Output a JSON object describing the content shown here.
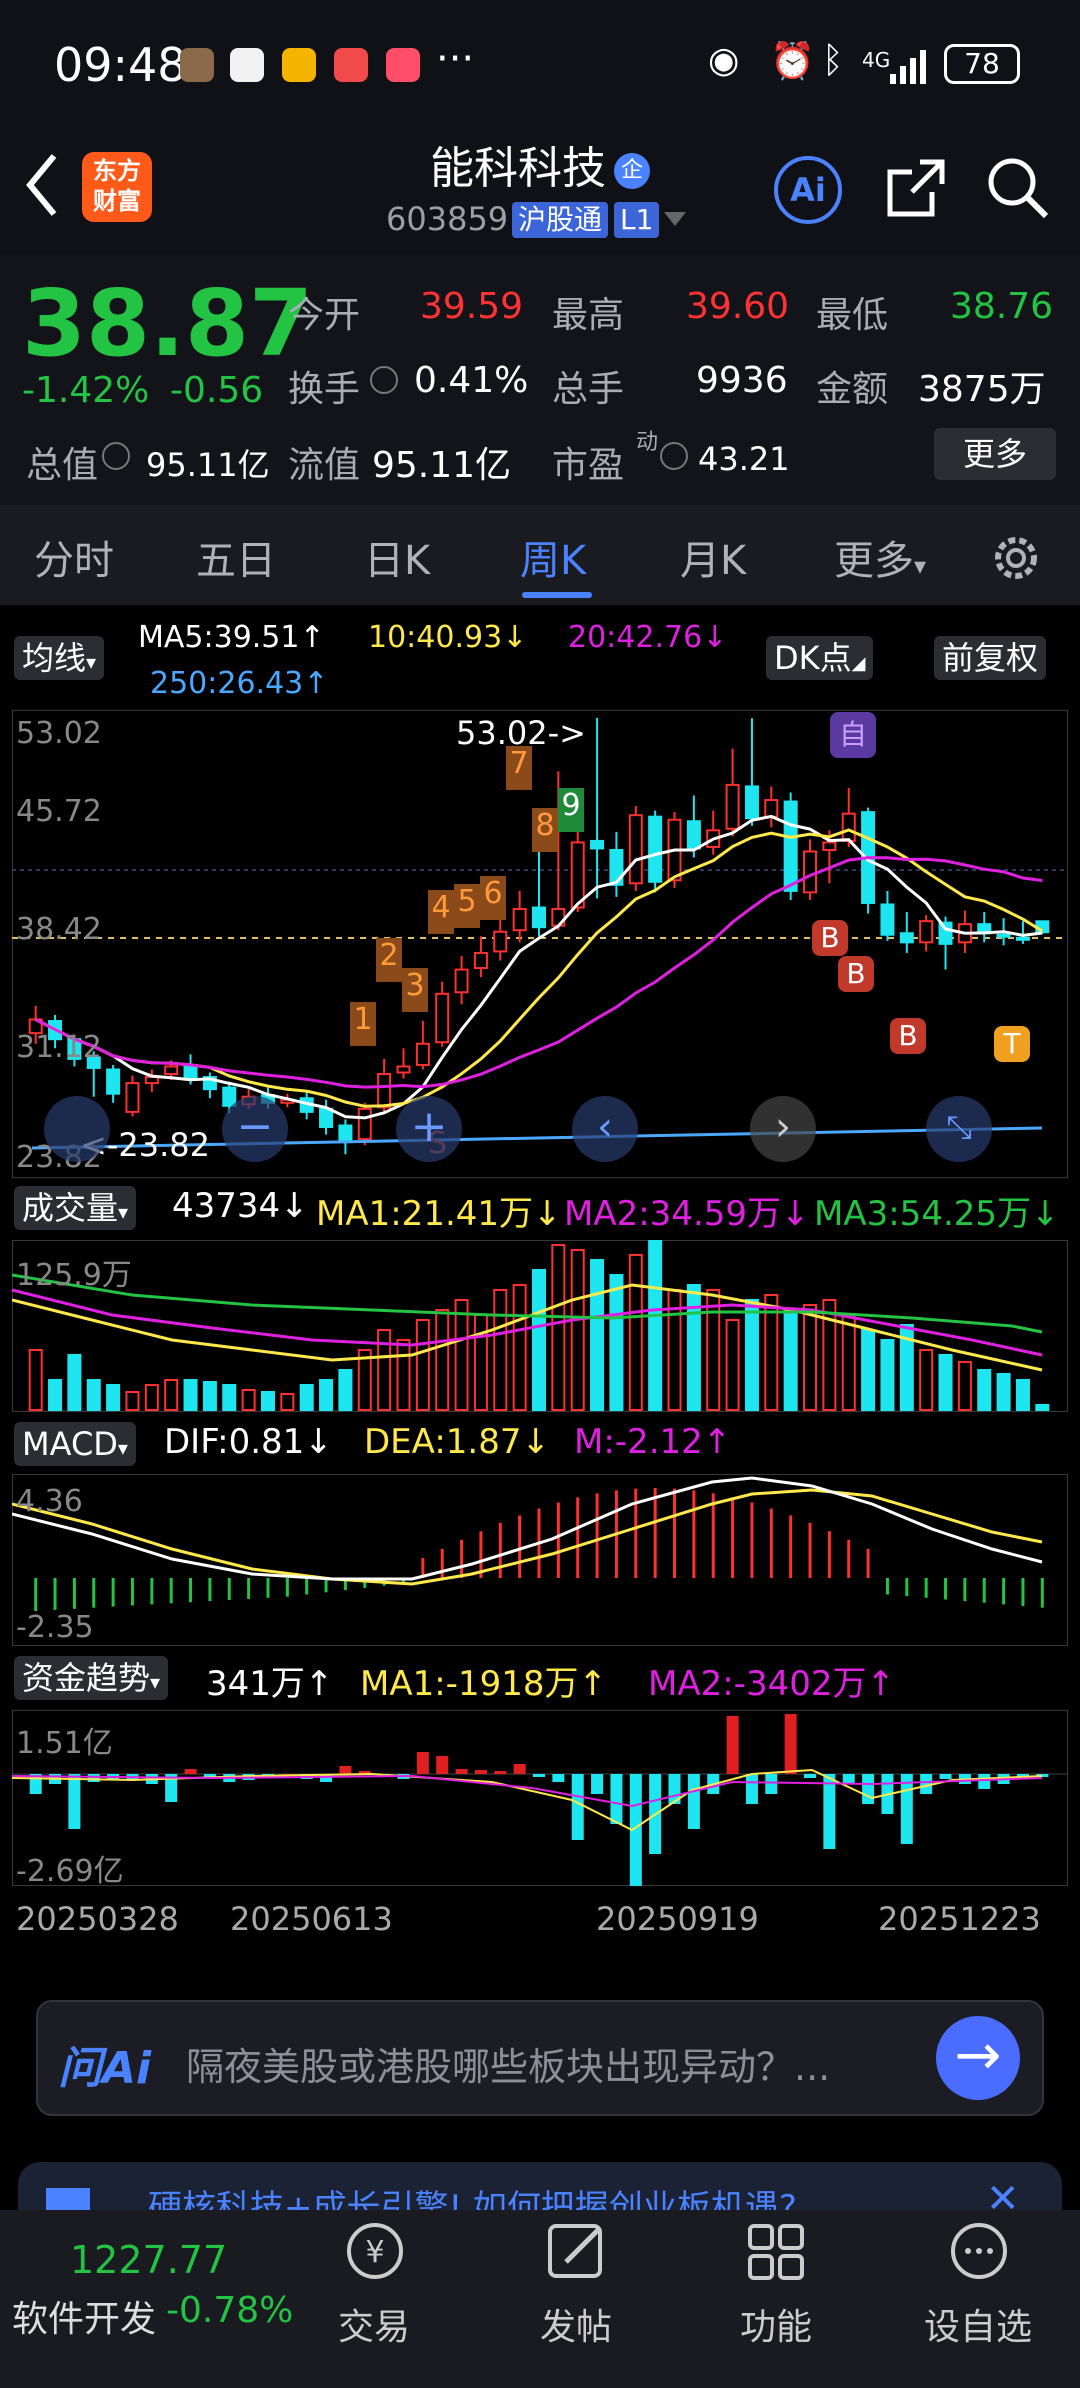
{
  "status_bar": {
    "time": "09:48",
    "dots": "···",
    "battery": "78",
    "net": "4G"
  },
  "header": {
    "logo_line1": "东方",
    "logo_line2": "财富",
    "name": "能科科技",
    "code": "603859",
    "tag_hgt": "沪股通",
    "tag_l1": "L1",
    "ai_label": "Ai"
  },
  "quote": {
    "price": "38.87",
    "change_pct": "-1.42%",
    "change_abs": "-0.56",
    "open_label": "今开",
    "open": "39.59",
    "high_label": "最高",
    "high": "39.60",
    "low_label": "最低",
    "low": "38.76",
    "turnover_label": "换手",
    "turnover": "0.41%",
    "volume_label": "总手",
    "volume": "9936",
    "amount_label": "金额",
    "amount": "3875万",
    "mktcap_label": "总值",
    "mktcap": "95.11亿",
    "float_label": "流值",
    "float": "95.11亿",
    "pe_label": "市盈",
    "pe_sup": "动",
    "pe": "43.21",
    "more": "更多"
  },
  "tabs": [
    "分时",
    "五日",
    "日K",
    "周K",
    "月K",
    "更多"
  ],
  "active_tab": "周K",
  "kline": {
    "ma_pill": "均线",
    "ma5": "MA5:39.51↑",
    "ma10": "10:40.93↓",
    "ma20": "20:42.76↓",
    "ma250": "250:26.43↑",
    "dk": "DK点",
    "adj": "前复权",
    "y_labels": [
      "53.02",
      "45.72",
      "38.42",
      "31.12",
      "23.82"
    ],
    "max_label": "53.02->",
    "min_label": "<-23.82",
    "signal_labels": [
      "1",
      "2",
      "3",
      "4",
      "5",
      "6",
      "7",
      "8",
      "9"
    ],
    "tag_self": "自",
    "tag_b": "B",
    "tag_t": "T",
    "tag_s": "S"
  },
  "volume": {
    "pill": "成交量",
    "value": "43734↓",
    "ma1": "MA1:21.41万↓",
    "ma2": "MA2:34.59万↓",
    "ma3": "MA3:54.25万↓",
    "max": "125.9万"
  },
  "macd": {
    "pill": "MACD",
    "dif": "DIF:0.81↓",
    "dea": "DEA:1.87↓",
    "m": "M:-2.12↑",
    "max": "4.36",
    "min": "-2.35"
  },
  "fund": {
    "pill": "资金趋势",
    "value": "341万↑",
    "ma1": "MA1:-1918万↑",
    "ma2": "MA2:-3402万↑",
    "max": "1.51亿",
    "min": "-2.69亿"
  },
  "dates": [
    "20250328",
    "20250613",
    "20250919",
    "20251223"
  ],
  "chart_data": {
    "type": "candlestick",
    "interval": "weekly",
    "ylim": [
      23.82,
      53.02
    ],
    "candles": [
      {
        "o": 32.2,
        "c": 33.1,
        "h": 34.0,
        "l": 31.5
      },
      {
        "o": 33.0,
        "c": 31.8,
        "h": 33.4,
        "l": 31.2
      },
      {
        "o": 31.8,
        "c": 30.5,
        "h": 32.1,
        "l": 30.0
      },
      {
        "o": 30.6,
        "c": 29.9,
        "h": 31.0,
        "l": 28.0
      },
      {
        "o": 29.8,
        "c": 28.2,
        "h": 30.1,
        "l": 27.6
      },
      {
        "o": 27.0,
        "c": 28.9,
        "h": 29.4,
        "l": 26.7
      },
      {
        "o": 28.9,
        "c": 29.3,
        "h": 29.8,
        "l": 28.3
      },
      {
        "o": 29.5,
        "c": 30.0,
        "h": 30.4,
        "l": 29.1
      },
      {
        "o": 30.0,
        "c": 29.2,
        "h": 30.8,
        "l": 28.8
      },
      {
        "o": 29.3,
        "c": 28.5,
        "h": 29.6,
        "l": 27.9
      },
      {
        "o": 28.6,
        "c": 27.4,
        "h": 29.0,
        "l": 26.9
      },
      {
        "o": 27.5,
        "c": 28.0,
        "h": 28.5,
        "l": 27.2
      },
      {
        "o": 28.1,
        "c": 27.6,
        "h": 28.6,
        "l": 27.2
      },
      {
        "o": 27.6,
        "c": 27.8,
        "h": 28.2,
        "l": 27.3
      },
      {
        "o": 27.9,
        "c": 27.0,
        "h": 28.3,
        "l": 26.5
      },
      {
        "o": 27.2,
        "c": 26.0,
        "h": 27.8,
        "l": 25.5
      },
      {
        "o": 26.1,
        "c": 25.0,
        "h": 26.5,
        "l": 24.2
      },
      {
        "o": 25.2,
        "c": 27.2,
        "h": 27.6,
        "l": 24.8
      },
      {
        "o": 27.3,
        "c": 29.5,
        "h": 30.5,
        "l": 26.9
      },
      {
        "o": 29.6,
        "c": 30.0,
        "h": 31.2,
        "l": 29.2
      },
      {
        "o": 30.1,
        "c": 31.5,
        "h": 33.0,
        "l": 29.8
      },
      {
        "o": 31.6,
        "c": 34.8,
        "h": 35.6,
        "l": 31.3
      },
      {
        "o": 34.9,
        "c": 36.4,
        "h": 37.3,
        "l": 34.1
      },
      {
        "o": 36.5,
        "c": 37.5,
        "h": 38.6,
        "l": 35.9
      },
      {
        "o": 37.6,
        "c": 38.9,
        "h": 39.7,
        "l": 37.0
      },
      {
        "o": 39.0,
        "c": 40.4,
        "h": 41.6,
        "l": 38.2
      },
      {
        "o": 40.5,
        "c": 39.2,
        "h": 44.5,
        "l": 38.6
      },
      {
        "o": 39.3,
        "c": 40.4,
        "h": 49.5,
        "l": 39.0
      },
      {
        "o": 40.5,
        "c": 44.8,
        "h": 47.0,
        "l": 40.2
      },
      {
        "o": 44.9,
        "c": 44.4,
        "h": 53.02,
        "l": 41.1
      },
      {
        "o": 44.3,
        "c": 42.0,
        "h": 45.5,
        "l": 41.2
      },
      {
        "o": 42.1,
        "c": 46.6,
        "h": 47.2,
        "l": 41.6
      },
      {
        "o": 46.5,
        "c": 42.2,
        "h": 46.9,
        "l": 41.5
      },
      {
        "o": 42.3,
        "c": 46.3,
        "h": 46.8,
        "l": 41.8
      },
      {
        "o": 46.2,
        "c": 44.4,
        "h": 47.9,
        "l": 43.8
      },
      {
        "o": 44.5,
        "c": 45.6,
        "h": 46.9,
        "l": 44.0
      },
      {
        "o": 45.7,
        "c": 48.6,
        "h": 51.0,
        "l": 45.2
      },
      {
        "o": 48.5,
        "c": 46.4,
        "h": 53.0,
        "l": 45.9
      },
      {
        "o": 46.5,
        "c": 47.6,
        "h": 48.5,
        "l": 45.8
      },
      {
        "o": 47.5,
        "c": 41.6,
        "h": 48.1,
        "l": 41.0
      },
      {
        "o": 41.5,
        "c": 44.2,
        "h": 45.0,
        "l": 41.0
      },
      {
        "o": 44.3,
        "c": 44.8,
        "h": 45.6,
        "l": 42.1
      },
      {
        "o": 44.9,
        "c": 46.7,
        "h": 48.4,
        "l": 44.5
      },
      {
        "o": 46.8,
        "c": 40.8,
        "h": 47.1,
        "l": 40.1
      },
      {
        "o": 40.7,
        "c": 38.7,
        "h": 41.6,
        "l": 38.3
      },
      {
        "o": 38.8,
        "c": 38.2,
        "h": 40.2,
        "l": 37.5
      },
      {
        "o": 38.2,
        "c": 39.6,
        "h": 40.0,
        "l": 37.6
      },
      {
        "o": 39.5,
        "c": 38.1,
        "h": 39.9,
        "l": 36.4
      },
      {
        "o": 38.2,
        "c": 39.4,
        "h": 40.3,
        "l": 37.5
      },
      {
        "o": 39.4,
        "c": 38.8,
        "h": 40.2,
        "l": 38.2
      },
      {
        "o": 38.7,
        "c": 38.6,
        "h": 39.8,
        "l": 38.0
      },
      {
        "o": 38.5,
        "c": 38.4,
        "h": 39.6,
        "l": 38.1
      },
      {
        "o": 39.59,
        "c": 38.87,
        "h": 39.6,
        "l": 38.76
      }
    ],
    "volume_max": "125.9万",
    "macd_range": [
      -2.35,
      4.36
    ],
    "fund_range": [
      "-2.69亿",
      "1.51亿"
    ]
  },
  "ai_bar": {
    "logo": "问Ai",
    "placeholder": "隔夜美股或港股哪些板块出现异动？..."
  },
  "banner": {
    "text": "硬核科技+成长引擎! 如何把握创业板机遇?"
  },
  "bottom_nav": {
    "index_value": "1227.77",
    "index_name": "软件开发",
    "index_change": "-0.78%",
    "items": [
      "交易",
      "发帖",
      "功能",
      "设自选"
    ]
  }
}
